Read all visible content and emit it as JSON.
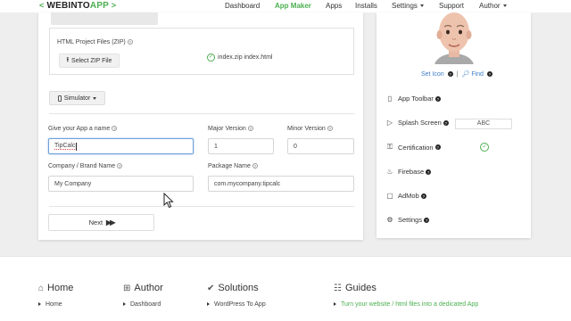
{
  "nav": {
    "logo_prefix": "<",
    "logo_brand": "WEBINTO",
    "logo_app": "APP",
    "logo_suffix": ">",
    "items": [
      {
        "label": "Dashboard"
      },
      {
        "label": "App Maker"
      },
      {
        "label": "Apps"
      },
      {
        "label": "Installs"
      },
      {
        "label": "Settings"
      },
      {
        "label": "Support"
      },
      {
        "label": "Author"
      }
    ]
  },
  "zip": {
    "title": "HTML Project Files (ZIP)",
    "button_label": "Select ZIP File",
    "status": "index.zip index.html"
  },
  "simulator": {
    "label": "Simulator"
  },
  "form": {
    "app_name_label": "Give your App a name",
    "app_name_value": "TipCalc",
    "major_label": "Major Version",
    "major_value": "1",
    "minor_label": "Minor Version",
    "minor_value": "0",
    "company_label": "Company / Brand Name",
    "company_value": "My Company",
    "package_label": "Package Name",
    "package_value": "com.mycompany.tipcalc",
    "next_label": "Next"
  },
  "right": {
    "set_icon": "Set Icon",
    "find": "Find",
    "features": [
      {
        "label": "App Toolbar",
        "icon": "phone-icon"
      },
      {
        "label": "Splash Screen",
        "icon": "play-icon"
      },
      {
        "label": "Certification",
        "icon": "key-icon"
      },
      {
        "label": "Firebase",
        "icon": "fire-icon"
      },
      {
        "label": "AdMob",
        "icon": "folder-icon"
      },
      {
        "label": "Settings",
        "icon": "gear-icon"
      }
    ],
    "splash_text": "ABC"
  },
  "footer": {
    "columns": [
      {
        "title": "Home",
        "icon": "bank-icon",
        "links": [
          "Home"
        ]
      },
      {
        "title": "Author",
        "icon": "grid-icon",
        "links": [
          "Dashboard"
        ]
      },
      {
        "title": "Solutions",
        "icon": "check-circle-icon",
        "links": [
          "WordPress To App"
        ]
      },
      {
        "title": "Guides",
        "icon": "book-icon",
        "links": [
          "Turn your website / html files into a dedicated App"
        ]
      }
    ]
  },
  "colors": {
    "accent": "#4caf50",
    "link": "#3d7dc8",
    "focus": "#6fa0d8"
  }
}
